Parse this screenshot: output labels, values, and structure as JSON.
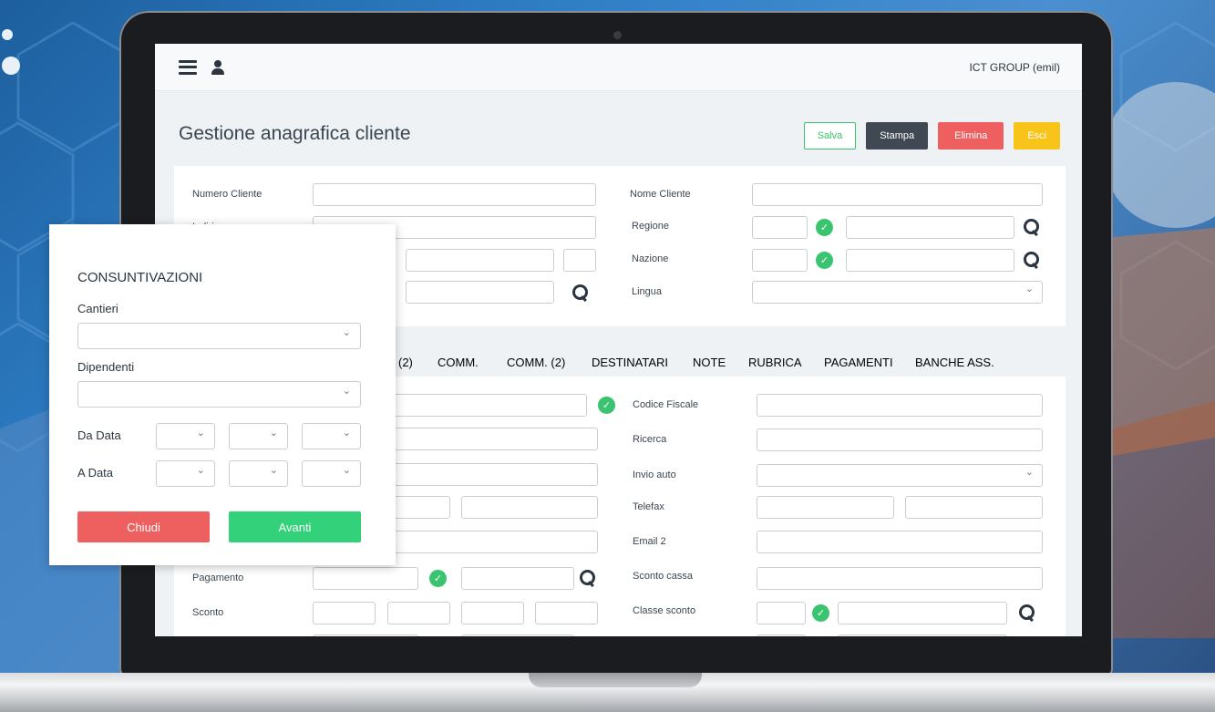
{
  "header": {
    "company": "ICT GROUP (emil)"
  },
  "page": {
    "title": "Gestione anagrafica cliente"
  },
  "actions": {
    "salva": "Salva",
    "stampa": "Stampa",
    "elimina": "Elimina",
    "esci": "Esci"
  },
  "form_top": {
    "numero_cliente": "Numero Cliente",
    "indirizzo": "Indirizzo",
    "nome_cliente": "Nome Cliente",
    "regione": "Regione",
    "nazione": "Nazione",
    "lingua": "Lingua"
  },
  "tabs": [
    "(2)",
    "COMM.",
    "COMM. (2)",
    "DESTINATARI",
    "NOTE",
    "RUBRICA",
    "PAGAMENTI",
    "BANCHE ASS."
  ],
  "form_bottom": {
    "codice_fiscale": "Codice Fiscale",
    "ricerca": "Ricerca",
    "invio_auto": "Invio auto",
    "telefax": "Telefax",
    "email2": "Email 2",
    "pagamento": "Pagamento",
    "sconto_cassa": "Sconto cassa",
    "sconto": "Sconto",
    "classe_sconto": "Classe sconto"
  },
  "dialog": {
    "title": "CONSUNTIVAZIONI",
    "cantieri": "Cantieri",
    "dipendenti": "Dipendenti",
    "da_data": "Da Data",
    "a_data": "A Data",
    "chiudi": "Chiudi",
    "avanti": "Avanti"
  },
  "colors": {
    "green": "#3bc46f",
    "red": "#ee5f5f",
    "yellow": "#f8c41a",
    "dark": "#3f4853"
  }
}
